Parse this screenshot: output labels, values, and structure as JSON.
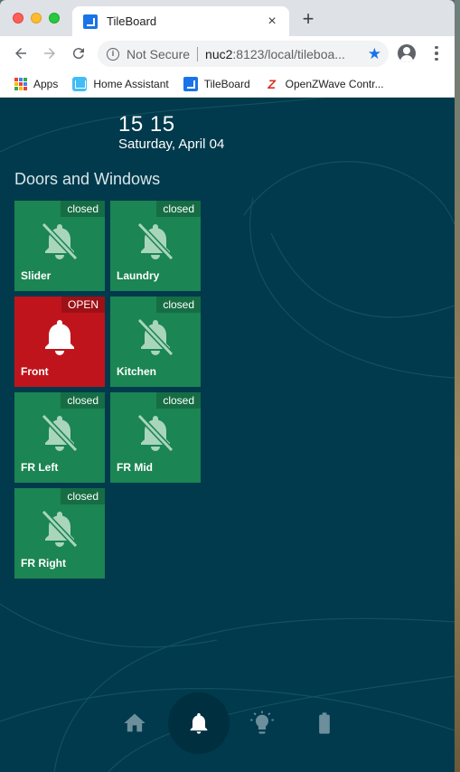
{
  "browser": {
    "tab_title": "TileBoard",
    "tab_close": "×",
    "new_tab": "+",
    "security_label": "Not Secure",
    "url_host": "nuc2",
    "url_rest": ":8123/local/tileboa...",
    "bookmarks": [
      {
        "label": "Apps",
        "icon": "apps-grid-icon"
      },
      {
        "label": "Home Assistant",
        "icon": "home-assistant-icon"
      },
      {
        "label": "TileBoard",
        "icon": "tileboard-icon"
      },
      {
        "label": "OpenZWave Contr...",
        "icon": "openzwave-icon"
      }
    ]
  },
  "header": {
    "time": "15 15",
    "date": "Saturday, April 04"
  },
  "group": {
    "title": "Doors and Windows"
  },
  "tiles": [
    {
      "label": "Slider",
      "state": "closed",
      "icon": "bell-off-icon"
    },
    {
      "label": "Laundry",
      "state": "closed",
      "icon": "bell-off-icon"
    },
    {
      "label": "Front",
      "state": "OPEN",
      "icon": "bell-icon"
    },
    {
      "label": "Kitchen",
      "state": "closed",
      "icon": "bell-off-icon"
    },
    {
      "label": "FR Left",
      "state": "closed",
      "icon": "bell-off-icon"
    },
    {
      "label": "FR Mid",
      "state": "closed",
      "icon": "bell-off-icon"
    },
    {
      "label": "FR Right",
      "state": "closed",
      "icon": "bell-off-icon"
    }
  ],
  "nav": [
    {
      "icon": "home-icon",
      "active": false
    },
    {
      "icon": "bell-icon",
      "active": true
    },
    {
      "icon": "lightbulb-icon",
      "active": false
    },
    {
      "icon": "battery-icon",
      "active": false
    }
  ],
  "colors": {
    "page_bg": "#003a4c",
    "tile_closed": "#1b8553",
    "tile_open": "#c0141c",
    "accent": "#1a73e8"
  }
}
